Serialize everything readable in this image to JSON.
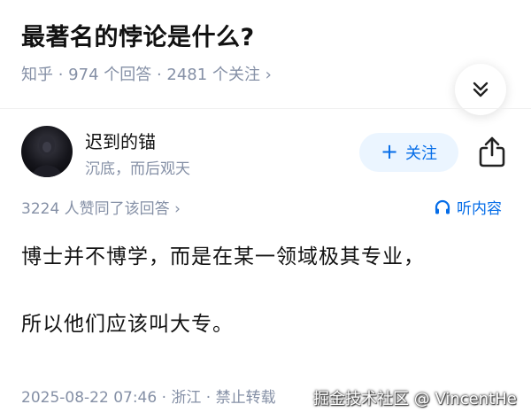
{
  "question": {
    "title": "最著名的悖论是什么?",
    "meta": "知乎 · 974 个回答 · 2481 个关注 ›"
  },
  "author": {
    "name": "迟到的锚",
    "bio": "沉底，而后观天",
    "follow_label": "关注",
    "follow_plus": "+"
  },
  "answer": {
    "upvotes": "3224 人赞同了该回答 ›",
    "listen_label": "听内容",
    "paragraphs": [
      "博士并不博学，而是在某一领域极其专业，",
      "所以他们应该叫大专。"
    ],
    "footer": "2025-08-22 07:46 · 浙江 · 禁止转载"
  },
  "watermark": "掘金技术社区 @ VincentHe",
  "colors": {
    "accent": "#056de8",
    "meta_gray": "#8590a6",
    "follow_bg": "#ebf5ff"
  },
  "icons": [
    "chevron-double-down-icon",
    "share-icon",
    "headphones-icon"
  ]
}
